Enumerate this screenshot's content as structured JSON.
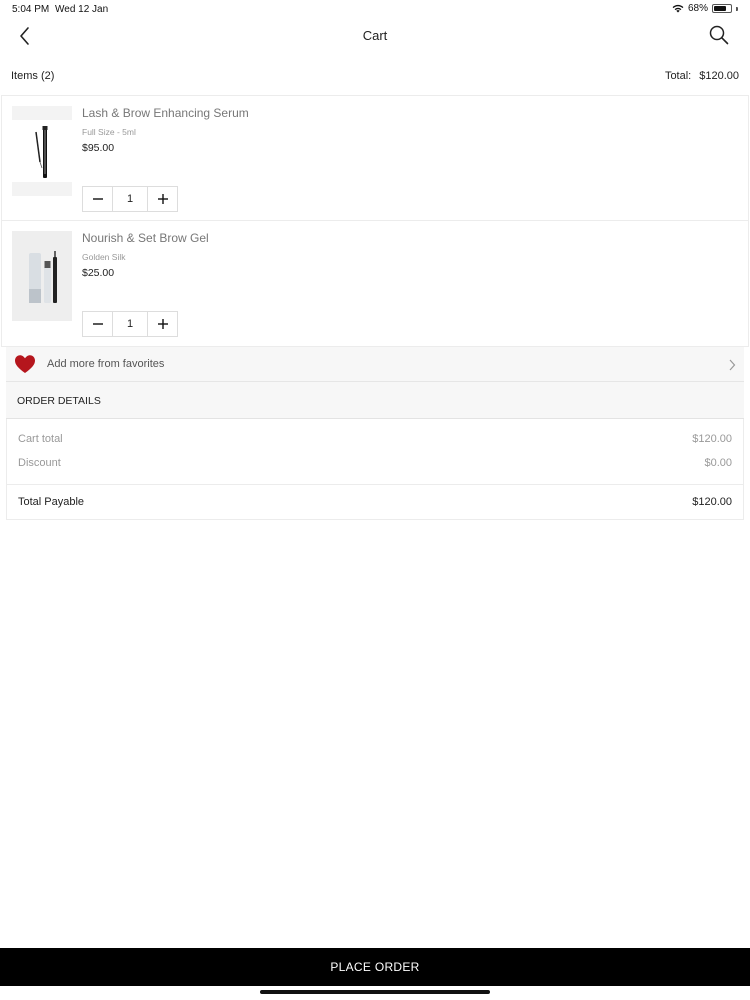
{
  "status_bar": {
    "time": "5:04 PM",
    "date": "Wed 12 Jan",
    "battery": "68%",
    "battery_level": 0.68
  },
  "header": {
    "title": "Cart",
    "back_icon": "chevron-left-icon",
    "search_icon": "search-icon"
  },
  "summary": {
    "items_label": "Items (2)",
    "total_label": "Total:",
    "total_value": "$120.00"
  },
  "cart_items": [
    {
      "name": "Lash & Brow Enhancing Serum",
      "variant": "Full Size - 5ml",
      "price": "$95.00",
      "quantity": "1"
    },
    {
      "name": "Nourish & Set Brow Gel",
      "variant": "Golden Silk",
      "price": "$25.00",
      "quantity": "1"
    }
  ],
  "favorites": {
    "label": "Add more from favorites",
    "icon": "heart-icon",
    "heart_color": "#b5161d"
  },
  "order_details": {
    "title": "ORDER DETAILS",
    "cart_total_label": "Cart total",
    "cart_total_value": "$120.00",
    "discount_label": "Discount",
    "discount_value": "$0.00",
    "payable_label": "Total Payable",
    "payable_value": "$120.00"
  },
  "place_order": {
    "label": "PLACE ORDER",
    "background": "#000000"
  }
}
